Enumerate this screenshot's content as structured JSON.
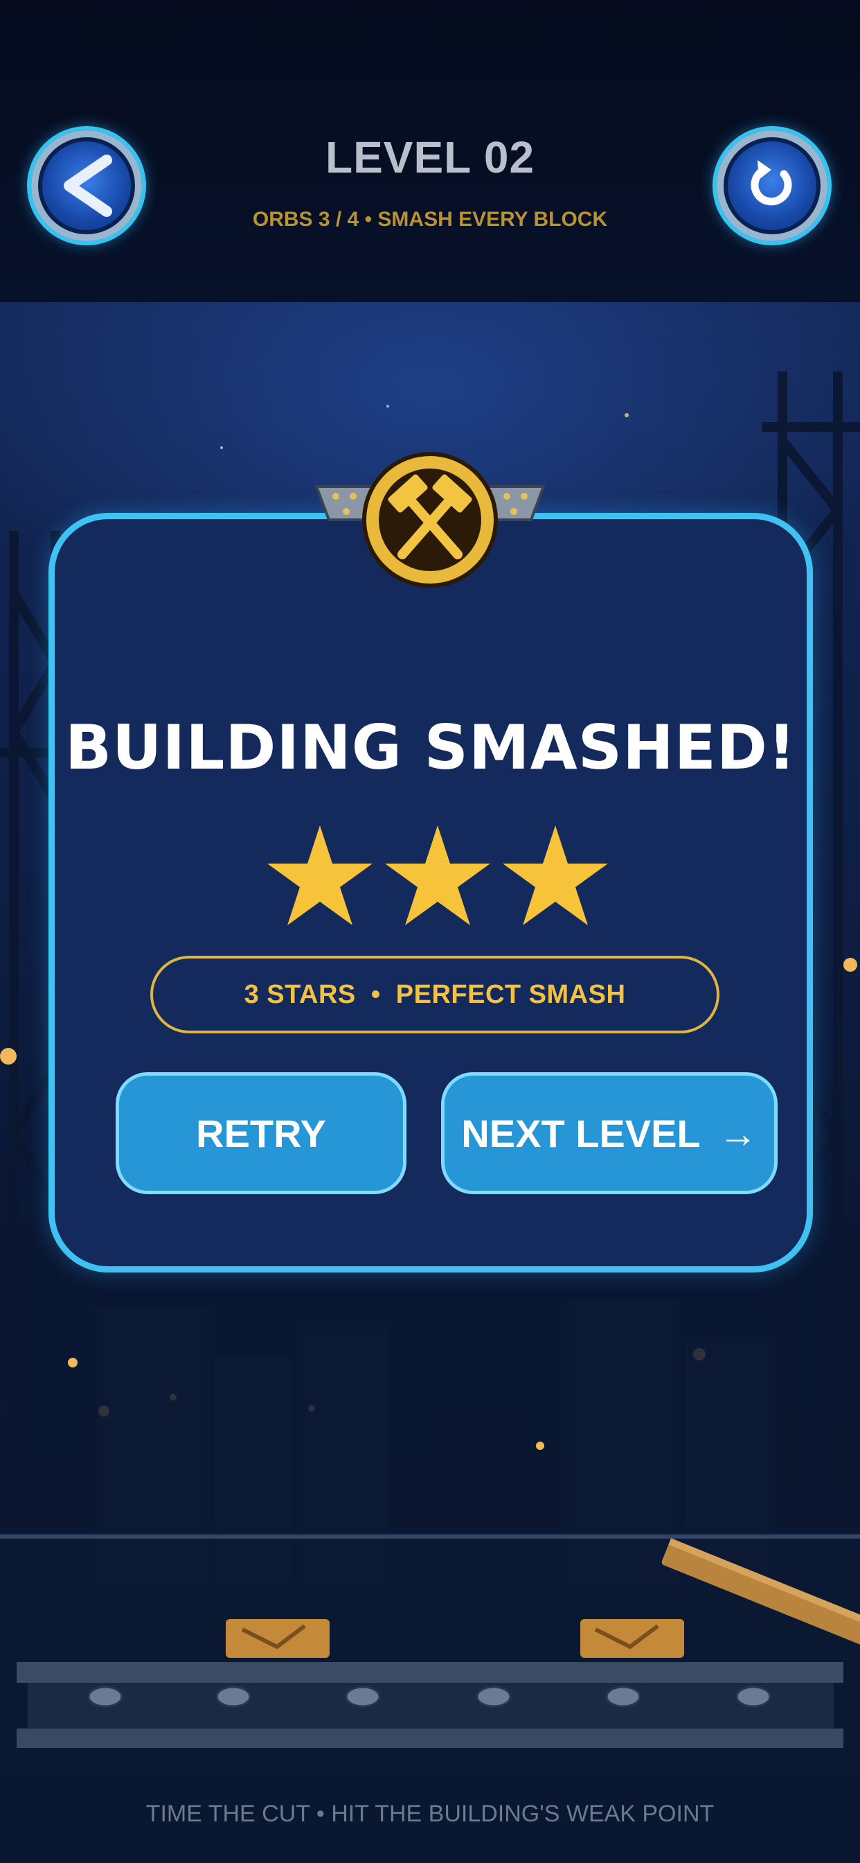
{
  "header": {
    "level_title": "LEVEL 02",
    "subtitle": "ORBS 3 / 4 • SMASH EVERY BLOCK",
    "back_icon": "chevron-left-icon",
    "reload_icon": "reload-icon"
  },
  "result_panel": {
    "emblem_icon": "hammer-crossed-icon",
    "title": "BUILDING SMASHED!",
    "stars_earned": 3,
    "stars_total": 3,
    "summary": "3 STARS  •  PERFECT SMASH",
    "retry_label": "RETRY",
    "next_label": "NEXT LEVEL",
    "next_arrow": "→"
  },
  "footer": {
    "hint": "TIME THE CUT • HIT THE BUILDING'S WEAK POINT"
  },
  "colors": {
    "panel_border": "#3fc2f2",
    "panel_bg": "#152a5c",
    "button_bg": "#2696d6",
    "star_gold": "#f6c33a",
    "pill_border": "#e0b53d",
    "subtitle_gold": "#b89334"
  }
}
